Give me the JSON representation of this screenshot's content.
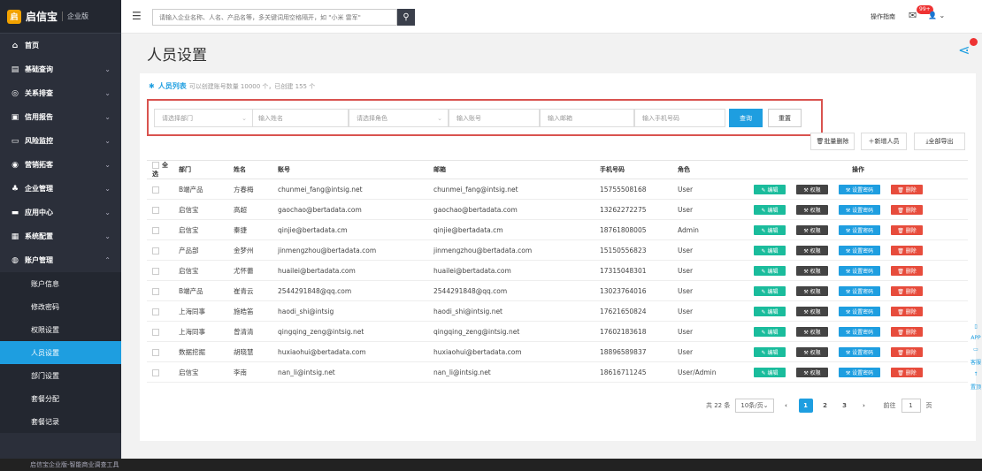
{
  "brand": {
    "logo_char": "启",
    "name": "启信宝",
    "edition": "企业版"
  },
  "search": {
    "placeholder": "请输入企业名称、人名、产品名等，多关键词用空格隔开，如 \"小米 雷军\""
  },
  "topbar": {
    "guide": "操作指南",
    "badge": "99+"
  },
  "menu": [
    {
      "icon": "home-icon",
      "glyph": "⌂",
      "label": "首页",
      "chevron": ""
    },
    {
      "icon": "document-icon",
      "glyph": "▤",
      "label": "基础查询",
      "chevron": "⌄"
    },
    {
      "icon": "relation-icon",
      "glyph": "◎",
      "label": "关系排查",
      "chevron": "⌄"
    },
    {
      "icon": "report-icon",
      "glyph": "▣",
      "label": "信用报告",
      "chevron": "⌄"
    },
    {
      "icon": "monitor-icon",
      "glyph": "▭",
      "label": "风险监控",
      "chevron": "⌄"
    },
    {
      "icon": "eye-icon",
      "glyph": "◉",
      "label": "营销拓客",
      "chevron": "⌄"
    },
    {
      "icon": "org-icon",
      "glyph": "♣",
      "label": "企业管理",
      "chevron": "⌄"
    },
    {
      "icon": "app-icon",
      "glyph": "▬",
      "label": "应用中心",
      "chevron": "⌄"
    },
    {
      "icon": "grid-icon",
      "glyph": "▦",
      "label": "系统配置",
      "chevron": "⌄"
    },
    {
      "icon": "account-icon",
      "glyph": "◍",
      "label": "账户管理",
      "chevron": "⌃"
    }
  ],
  "submenu": [
    "账户信息",
    "修改密码",
    "权限设置",
    "人员设置",
    "部门设置",
    "套餐分配",
    "套餐记录"
  ],
  "submenu_active": 3,
  "footer": "启信宝企业版-智能商业调查工具",
  "page": {
    "title": "人员设置"
  },
  "list": {
    "title": "人员列表",
    "hint": "可以创建账号数量 10000 个，已创建 155 个"
  },
  "filters": {
    "dept": "请选择部门",
    "name": "输入姓名",
    "role": "请选择角色",
    "account": "输入账号",
    "email": "输入邮箱",
    "phone": "输入手机号码",
    "query": "查询",
    "reset": "重置"
  },
  "actions": {
    "batch_delete": "批量删除",
    "add": "新增人员",
    "export": "全部导出"
  },
  "columns": [
    "全选",
    "部门",
    "姓名",
    "账号",
    "邮箱",
    "手机号码",
    "角色",
    "操作"
  ],
  "op_labels": {
    "edit": "编辑",
    "perm": "权限",
    "pwd": "设置密码",
    "del": "删除"
  },
  "rows": [
    [
      "B端产品",
      "方春梅",
      "chunmei_fang@intsig.net",
      "chunmei_fang@intsig.net",
      "15755508168",
      "User"
    ],
    [
      "启信宝",
      "高超",
      "gaochao@bertadata.com",
      "gaochao@bertadata.com",
      "13262272275",
      "User"
    ],
    [
      "启信宝",
      "秦捷",
      "qinjie@bertadata.cm",
      "qinjie@bertadata.cm",
      "18761808005",
      "Admin"
    ],
    [
      "产品部",
      "金梦州",
      "jinmengzhou@bertadata.com",
      "jinmengzhou@bertadata.com",
      "15150556823",
      "User"
    ],
    [
      "启信宝",
      "尤怀蕾",
      "huailei@bertadata.com",
      "huailei@bertadata.com",
      "17315048301",
      "User"
    ],
    [
      "B端产品",
      "崔青云",
      "2544291848@qq.com",
      "2544291848@qq.com",
      "13023764016",
      "User"
    ],
    [
      "上海同事",
      "施皓笛",
      "haodi_shi@intsig",
      "haodi_shi@intsig.net",
      "17621650824",
      "User"
    ],
    [
      "上海同事",
      "曾清清",
      "qingqing_zeng@intsig.net",
      "qingqing_zeng@intsig.net",
      "17602183618",
      "User"
    ],
    [
      "数据挖掘",
      "胡晓慧",
      "huxiaohui@bertadata.com",
      "huxiaohui@bertadata.com",
      "18896589837",
      "User"
    ],
    [
      "启信宝",
      "李南",
      "nan_li@intsig.net",
      "nan_li@intsig.net",
      "18616711245",
      "User/Admin"
    ]
  ],
  "pager": {
    "total": "共 22 条",
    "page_size": "10条/页",
    "pages": [
      "1",
      "2",
      "3"
    ],
    "current": "1",
    "goto": "前往",
    "goto_value": "1",
    "page_unit": "页"
  },
  "right_tools": [
    "APP",
    "客服",
    "置顶"
  ],
  "colors": {
    "accent": "#1e9ee0",
    "sidebar": "#2b2f3a",
    "edit": "#1abc9c",
    "perm": "#444444",
    "delete": "#e74c3c",
    "highlight": "#d9534f"
  }
}
